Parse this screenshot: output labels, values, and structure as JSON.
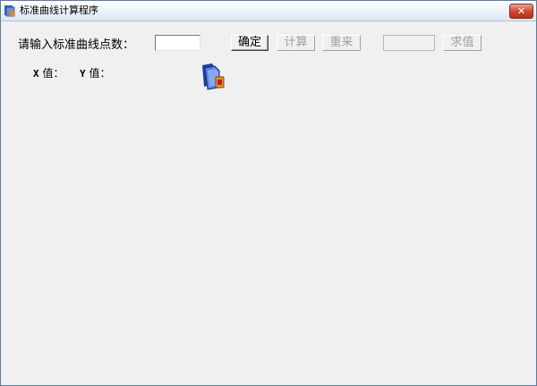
{
  "window": {
    "title": "标准曲线计算程序",
    "close_glyph": "✕"
  },
  "form": {
    "points_label": "请输入标准曲线点数：",
    "points_value": "",
    "confirm_button": "确定",
    "calculate_button": "计算",
    "reset_button": "重来",
    "input_value": "",
    "find_value_button": "求值"
  },
  "headers": {
    "x_axis": "X",
    "x_value": " 值：",
    "y_axis": "Y",
    "y_value": " 值："
  },
  "icons": {
    "app": "app-icon",
    "decoration": "book-folder-icon"
  }
}
